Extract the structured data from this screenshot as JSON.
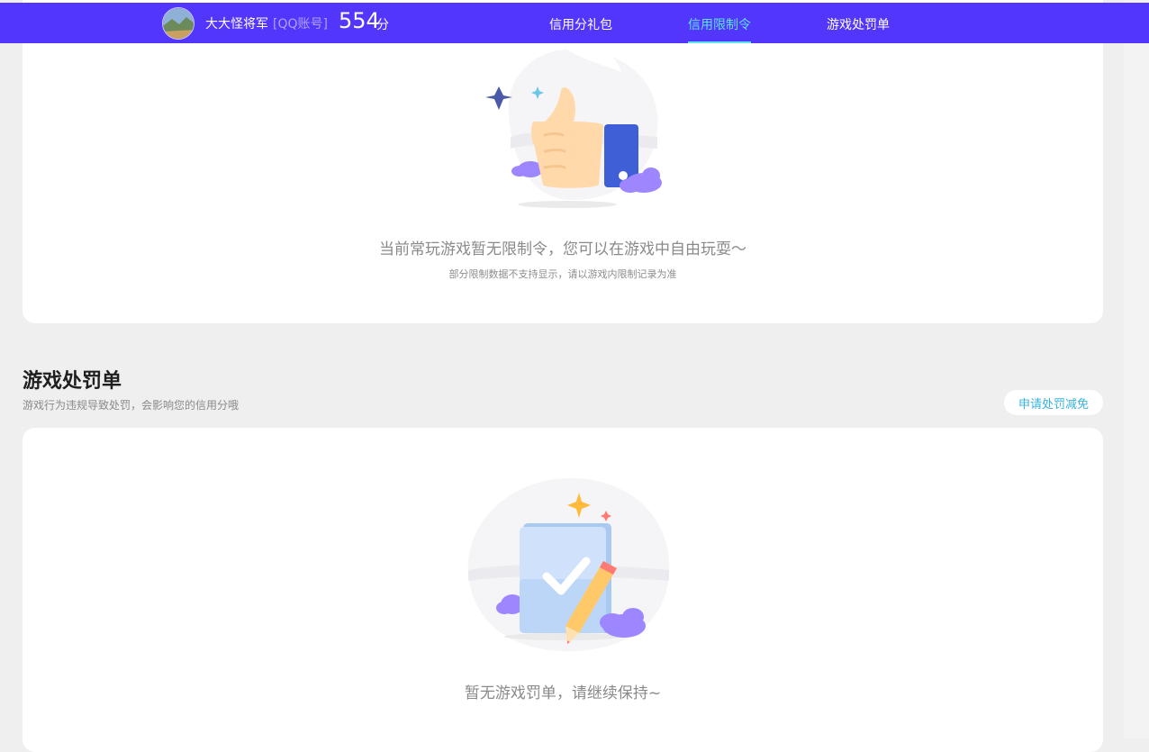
{
  "header": {
    "username": "大大怪将军",
    "account_type": "[QQ账号]",
    "score": "554",
    "score_unit": "分",
    "tabs": [
      {
        "label": "信用分礼包",
        "active": false
      },
      {
        "label": "信用限制令",
        "active": true
      },
      {
        "label": "游戏处罚单",
        "active": false
      }
    ],
    "accent_color": "#5236fb",
    "active_tab_color": "#5fe3f5"
  },
  "restriction_card": {
    "icon": "thumbs-up-illustration",
    "message": "当前常玩游戏暂无限制令，您可以在游戏中自由玩耍～",
    "note": "部分限制数据不支持显示，请以游戏内限制记录为准"
  },
  "penalty_section": {
    "title": "游戏处罚单",
    "description": "游戏行为违规导致处罚，会影响您的信用分哦",
    "appeal_button": "申请处罚减免",
    "icon": "clipboard-check-illustration",
    "empty_message": "暂无游戏罚单，请继续保持~"
  }
}
